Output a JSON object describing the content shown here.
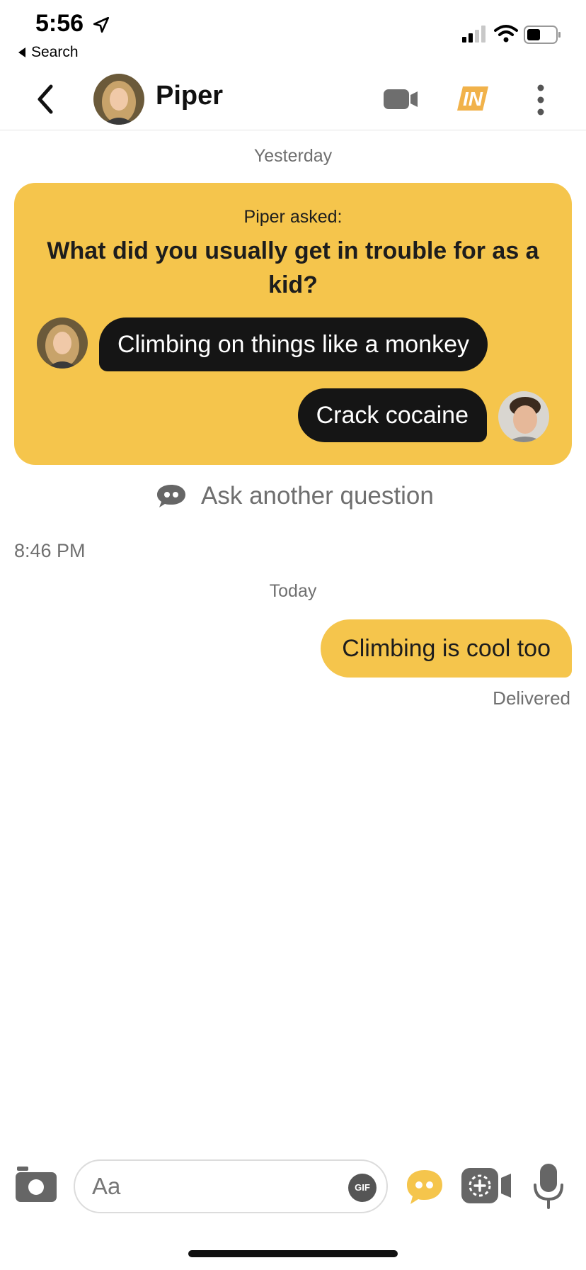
{
  "status_bar": {
    "time": "5:56",
    "back_app_label": "Search"
  },
  "header": {
    "contact_name": "Piper",
    "in_badge": "IN"
  },
  "conversation": {
    "day_yesterday": "Yesterday",
    "question_card": {
      "asked_label": "Piper asked:",
      "question": "What did you usually get in trouble for as a kid?",
      "piper_answer": "Climbing on things like a monkey",
      "my_answer": "Crack cocaine"
    },
    "ask_another_label": "Ask another question",
    "timestamp": "8:46 PM",
    "day_today": "Today",
    "my_message": "Climbing is cool too",
    "delivery_status": "Delivered"
  },
  "composer": {
    "placeholder": "Aa",
    "gif_label": "GIF"
  },
  "colors": {
    "accent": "#f5c54c",
    "bubble_dark": "#151515",
    "muted_text": "#6f6f6f"
  }
}
